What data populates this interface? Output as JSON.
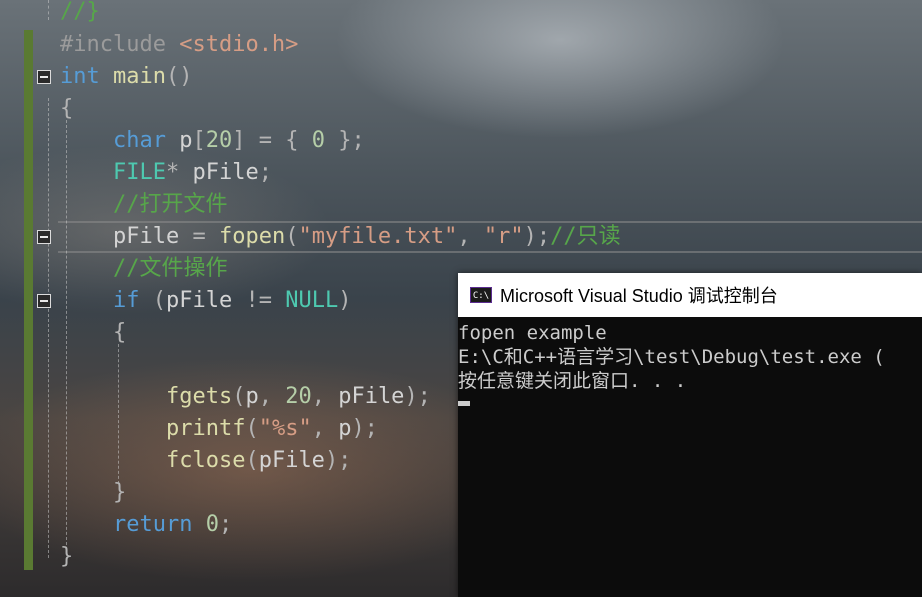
{
  "editor": {
    "line_prev": "//}",
    "include_directive": "#include",
    "include_file": "<stdio.h>",
    "kw_int": "int",
    "fn_main": "main",
    "paren_open_close": "()",
    "brace_open": "{",
    "brace_close": "}",
    "kw_char": "char",
    "var_p": "p",
    "num_20": "20",
    "num_0": "0",
    "type_file": "FILE",
    "var_pfile": "pFile",
    "comment_open_file": "//打开文件",
    "fn_fopen": "fopen",
    "str_filename": "\"myfile.txt\"",
    "str_mode": "\"r\"",
    "comment_readonly": "//只读",
    "comment_file_ops": "//文件操作",
    "kw_if": "if",
    "null": "NULL",
    "fn_fgets": "fgets",
    "fn_printf": "printf",
    "str_fmt": "\"%s\"",
    "fn_fclose": "fclose",
    "kw_return": "return"
  },
  "console": {
    "icon_label": "C:\\",
    "title": "Microsoft Visual Studio 调试控制台",
    "lines": [
      "fopen example",
      "E:\\C和C++语言学习\\test\\Debug\\test.exe (",
      "按任意键关闭此窗口. . ."
    ]
  }
}
